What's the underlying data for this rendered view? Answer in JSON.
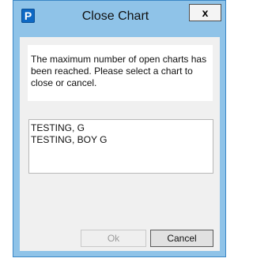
{
  "window": {
    "title": "Close Chart",
    "app_icon_letter": "P",
    "close_label": "x"
  },
  "message": "The maximum number of open charts has been reached.   Please select a chart to close or cancel.",
  "charts": [
    {
      "name": "TESTING, G"
    },
    {
      "name": "TESTING, BOY G"
    }
  ],
  "buttons": {
    "ok": "Ok",
    "ok_enabled": false,
    "cancel": "Cancel"
  },
  "colors": {
    "frame": "#8fc3e8",
    "app_icon": "#0d68c4",
    "client_bg": "#f0f0f0"
  }
}
